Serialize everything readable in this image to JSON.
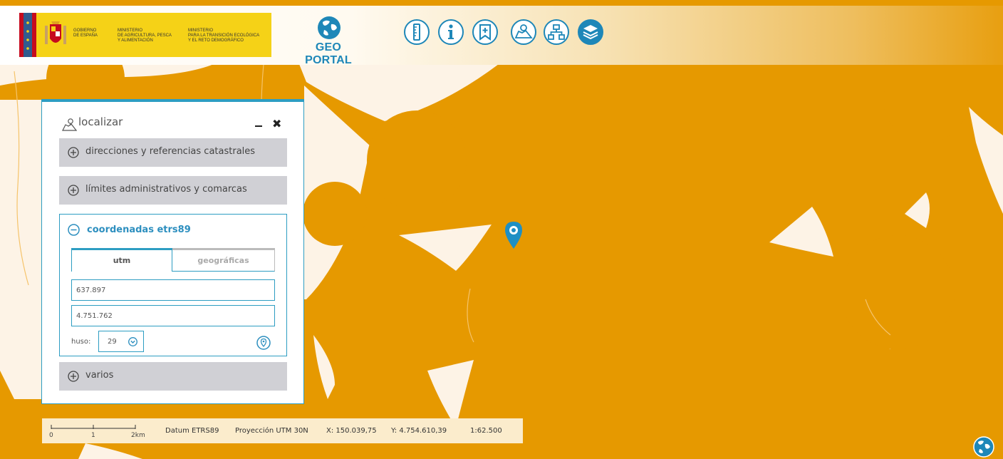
{
  "colors": {
    "map_fill": "#e69900",
    "map_land": "#fdf3e6",
    "accent": "#2d9dc2",
    "section_bg": "#d0d0d5",
    "gov_yellow": "#f5d217",
    "flag_red": "#c60b1e"
  },
  "header": {
    "gov": {
      "gobierno": "GOBIERNO\nDE ESPAÑA",
      "ministerio_agricultura": "MINISTERIO\nDE AGRICULTURA, PESCA\nY ALIMENTACIÓN",
      "ministerio_transicion": "MINISTERIO\nPARA LA TRANSICIÓN ECOLÓGICA\nY EL RETO DEMOGRÁFICO"
    },
    "geo_title": "GEO PORTAL",
    "toolbar": [
      {
        "icon": "ruler-icon"
      },
      {
        "icon": "info-icon"
      },
      {
        "icon": "bookmark-add-icon"
      },
      {
        "icon": "map-search-icon"
      },
      {
        "icon": "sitemap-icon"
      },
      {
        "icon": "layers-icon"
      }
    ]
  },
  "panel": {
    "title": "localizar",
    "sections": {
      "direcciones": "direcciones y referencias catastrales",
      "limites": "límites administrativos y comarcas",
      "coordenadas": "coordenadas etrs89",
      "varios": "varios"
    },
    "tabs": {
      "utm": "utm",
      "geograficas": "geográficas"
    },
    "utm_x": "637.897",
    "utm_y": "4.751.762",
    "huso_label": "huso:",
    "huso_value": "29"
  },
  "footer": {
    "scale_ticks": [
      "0",
      "1",
      "2km"
    ],
    "datum": "Datum ETRS89",
    "projection": "Proyección UTM 30N",
    "x": "X: 150.039,75",
    "y": "Y: 4.754.610,39",
    "scale": "1:62.500"
  }
}
